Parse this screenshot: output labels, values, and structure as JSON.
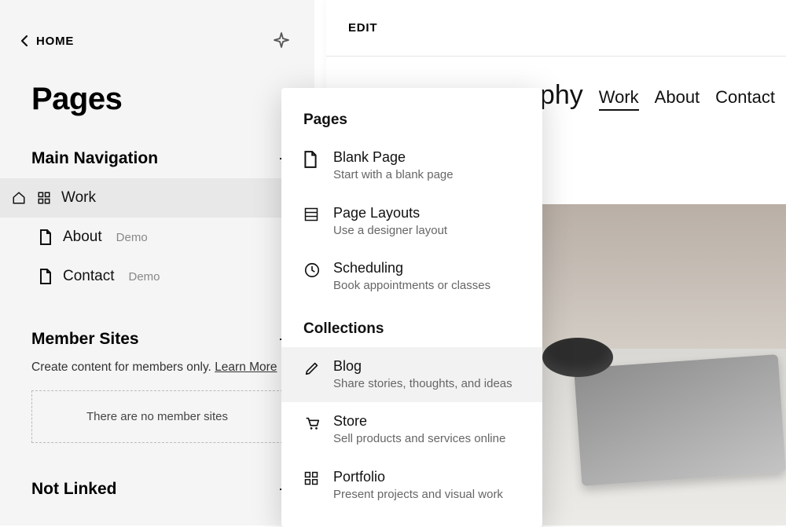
{
  "sidebar": {
    "home": "HOME",
    "title": "Pages",
    "sections": {
      "main_nav": {
        "title": "Main Navigation",
        "items": [
          {
            "label": "Work",
            "demo": false,
            "active": true
          },
          {
            "label": "About",
            "demo": true,
            "active": false
          },
          {
            "label": "Contact",
            "demo": true,
            "active": false
          }
        ]
      },
      "member_sites": {
        "title": "Member Sites",
        "description_pre": "Create content for members only. ",
        "learn_more": "Learn More",
        "empty": "There are no member sites"
      },
      "not_linked": {
        "title": "Not Linked"
      }
    },
    "demo_tag": "Demo"
  },
  "popover": {
    "section_pages": "Pages",
    "section_collections": "Collections",
    "items_pages": [
      {
        "title": "Blank Page",
        "desc": "Start with a blank page",
        "icon": "page"
      },
      {
        "title": "Page Layouts",
        "desc": "Use a designer layout",
        "icon": "layouts"
      },
      {
        "title": "Scheduling",
        "desc": "Book appointments or classes",
        "icon": "clock"
      }
    ],
    "items_collections": [
      {
        "title": "Blog",
        "desc": "Share stories, thoughts, and ideas",
        "icon": "pen",
        "selected": true
      },
      {
        "title": "Store",
        "desc": "Sell products and services online",
        "icon": "cart",
        "selected": false
      },
      {
        "title": "Portfolio",
        "desc": "Present projects and visual work",
        "icon": "grid",
        "selected": false
      }
    ]
  },
  "preview": {
    "edit": "EDIT",
    "brand_fragment": "raphy",
    "nav": [
      {
        "label": "Work",
        "active": true
      },
      {
        "label": "About",
        "active": false
      },
      {
        "label": "Contact",
        "active": false
      }
    ]
  }
}
